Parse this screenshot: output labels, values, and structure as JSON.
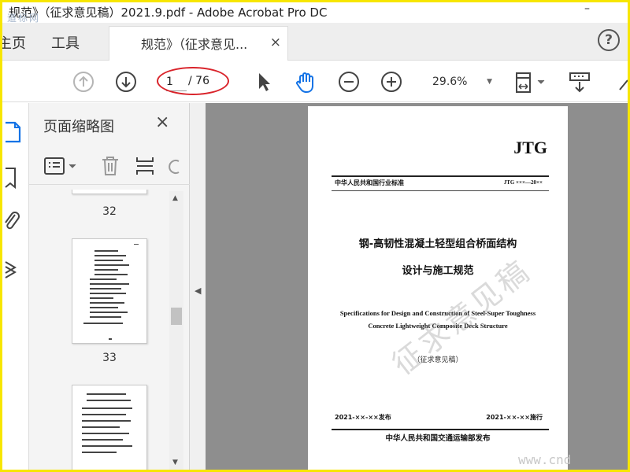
{
  "window": {
    "title": "规范》（征求意见稿）2021.9.pdf - Adobe Acrobat Pro DC",
    "minimize": "–"
  },
  "watermark_logo": "道标网",
  "tabs": {
    "home_partial": "主页",
    "tools": "工具",
    "document": "规范》（征求意见...",
    "close": "×",
    "help": "?"
  },
  "toolbar": {
    "current_page": "1",
    "total_pages": "/ 76",
    "zoom": "29.6%"
  },
  "thumbnail_panel": {
    "title": "页面缩略图",
    "close": "×",
    "labels": [
      "32",
      "33"
    ]
  },
  "page": {
    "logo": "JTG",
    "standard_type": "中华人民共和国行业标准",
    "standard_no": "JTG ×××—20××",
    "title_cn_line1": "钢-高韧性混凝土轻型组合桥面结构",
    "title_cn_line2": "设计与施工规范",
    "title_en_line1": "Specifications for Design and Construction of Steel-Super Toughness",
    "title_en_line2": "Concrete Lightweight Composite Deck Structure",
    "draft_note": "（征求意见稿）",
    "release": "2021-××-××发布",
    "implement": "2021-××-××施行",
    "issuer": "中华人民共和国交通运输部发布",
    "stamp": "征求意见稿"
  },
  "site_watermark": "www.cnd",
  "colors": {
    "border": "#f7e600",
    "annotation_ring": "#d9232a",
    "doc_background": "#8e8e8e",
    "selected_icon": "#1473e6"
  }
}
